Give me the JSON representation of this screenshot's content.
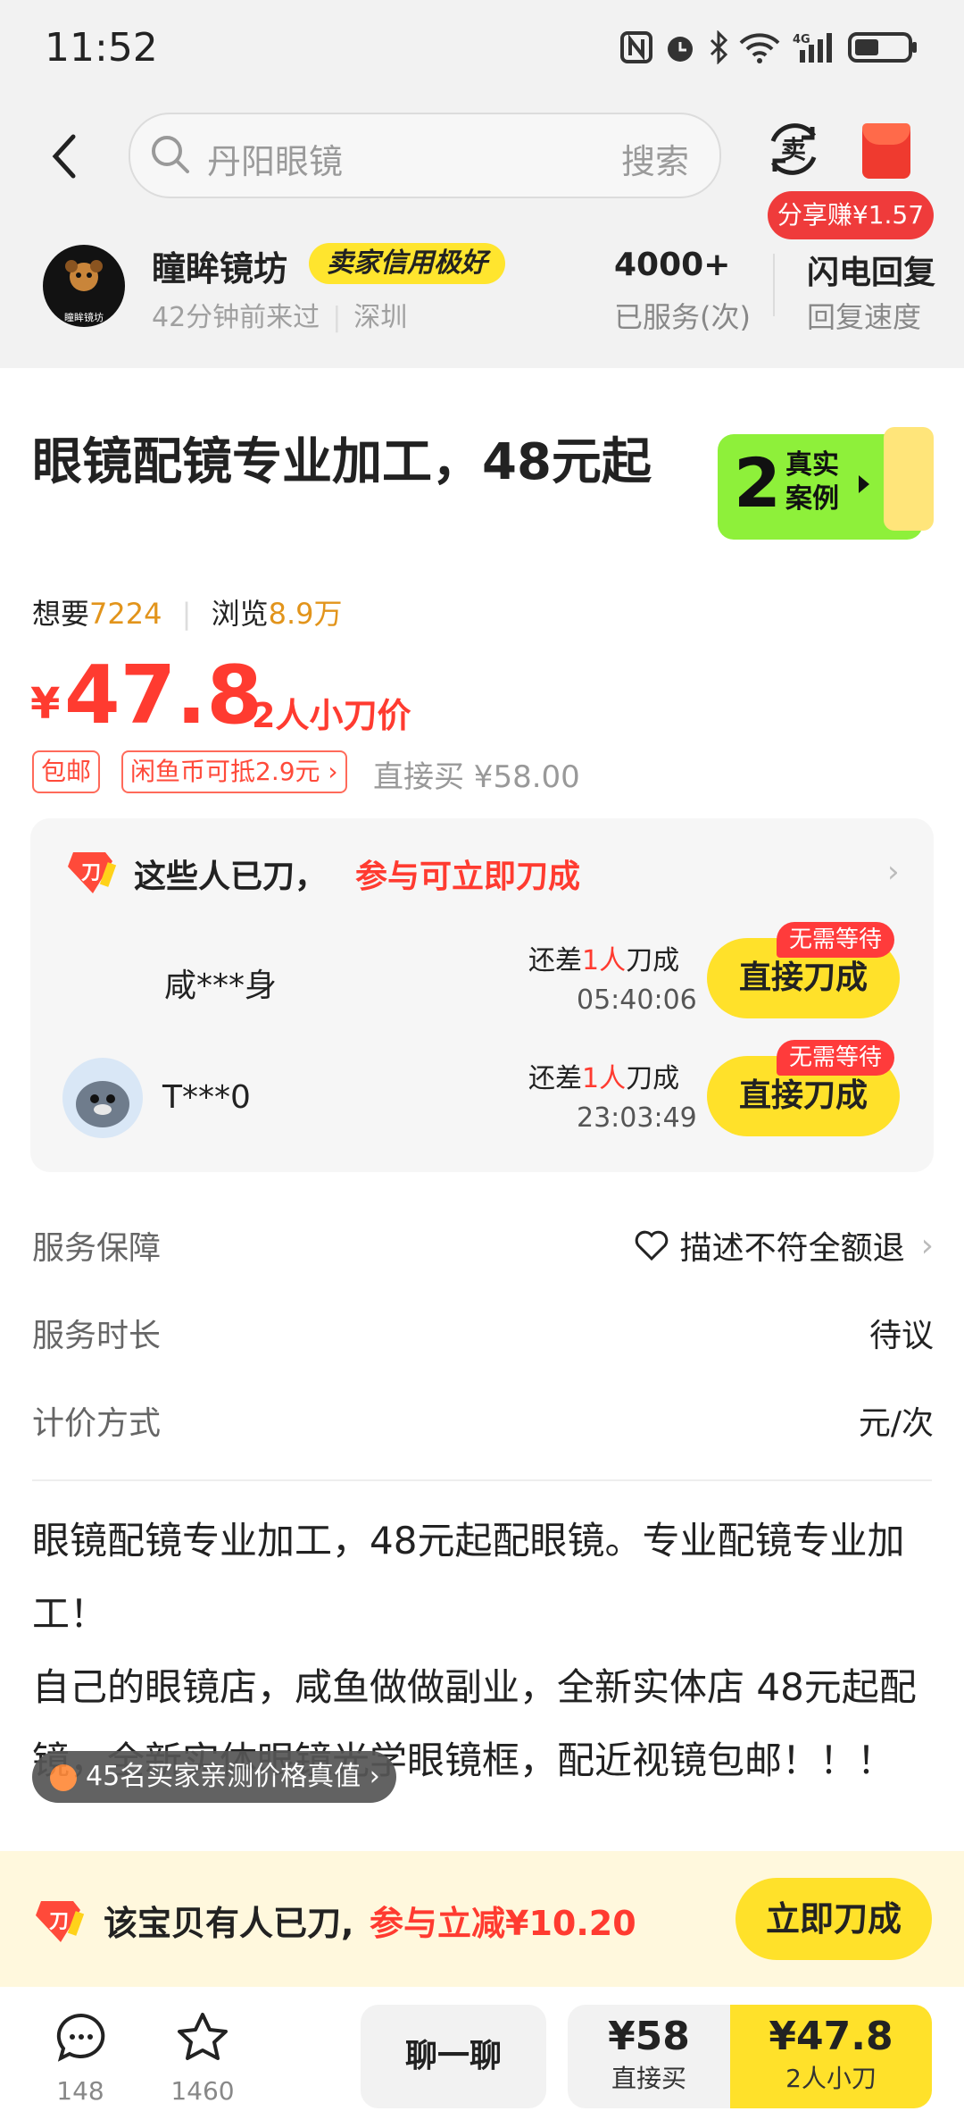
{
  "status_bar": {
    "time": "11:52"
  },
  "search": {
    "placeholder": "丹阳眼镜",
    "button": "搜索"
  },
  "header": {
    "share_label": "分享赚¥1.57"
  },
  "seller": {
    "avatar_text": "瞳眸镜坊",
    "name": "瞳眸镜坊",
    "credit_badge": "卖家信用极好",
    "last_visit": "42分钟前来过",
    "location": "深圳",
    "served_count": "4000+",
    "served_label": "已服务(次)",
    "reply_speed": "闪电回复",
    "reply_label": "回复速度"
  },
  "product": {
    "title": "眼镜配镜专业加工，48元起",
    "real_cases_count": "2",
    "real_cases_label_1": "真实",
    "real_cases_label_2": "案例",
    "want_label": "想要",
    "want_count": "7224",
    "views_label": "浏览",
    "views_count": "8.9万",
    "currency": "¥",
    "price": "47.8",
    "price_note": "2人小刀价",
    "tag_free_shipping": "包邮",
    "tag_coins": "闲鱼币可抵2.9元",
    "direct_buy_text": "直接买 ¥58.00"
  },
  "bargain": {
    "title": "这些人已刀，",
    "title_highlight": "参与可立即刀成",
    "people": [
      {
        "name": "咸***身",
        "need_prefix": "还差",
        "need_count": "1人",
        "need_suffix": "刀成",
        "timer": "05:40:06",
        "button": "直接刀成",
        "badge": "无需等待"
      },
      {
        "name": "T***0",
        "need_prefix": "还差",
        "need_count": "1人",
        "need_suffix": "刀成",
        "timer": "23:03:49",
        "button": "直接刀成",
        "badge": "无需等待"
      }
    ]
  },
  "service": {
    "guarantee_label": "服务保障",
    "guarantee_value": "描述不符全额退",
    "duration_label": "服务时长",
    "duration_value": "待议",
    "pricing_label": "计价方式",
    "pricing_value": "元/次"
  },
  "description": {
    "line1": "眼镜配镜专业加工，48元起配眼镜。专业配镜专业加工！",
    "line2": "自己的眼镜店，咸鱼做做副业，全新实体店 48元起配镜，全新实体眼镜光学眼镜框，配近视镜包邮！！！"
  },
  "float_badge": {
    "text": "45名买家亲测价格真值"
  },
  "cut_bar": {
    "text": "该宝贝有人已刀,",
    "highlight": "参与立减¥10.20",
    "button": "立即刀成"
  },
  "tab_bar": {
    "comments_count": "148",
    "favorites_count": "1460",
    "chat": "聊一聊",
    "direct_price": "¥58",
    "direct_label": "直接买",
    "group_price": "¥47.8",
    "group_label": "2人小刀"
  },
  "colors": {
    "accent_red": "#ff3b30",
    "accent_yellow": "#ffe12a",
    "orange": "#e2941b"
  }
}
